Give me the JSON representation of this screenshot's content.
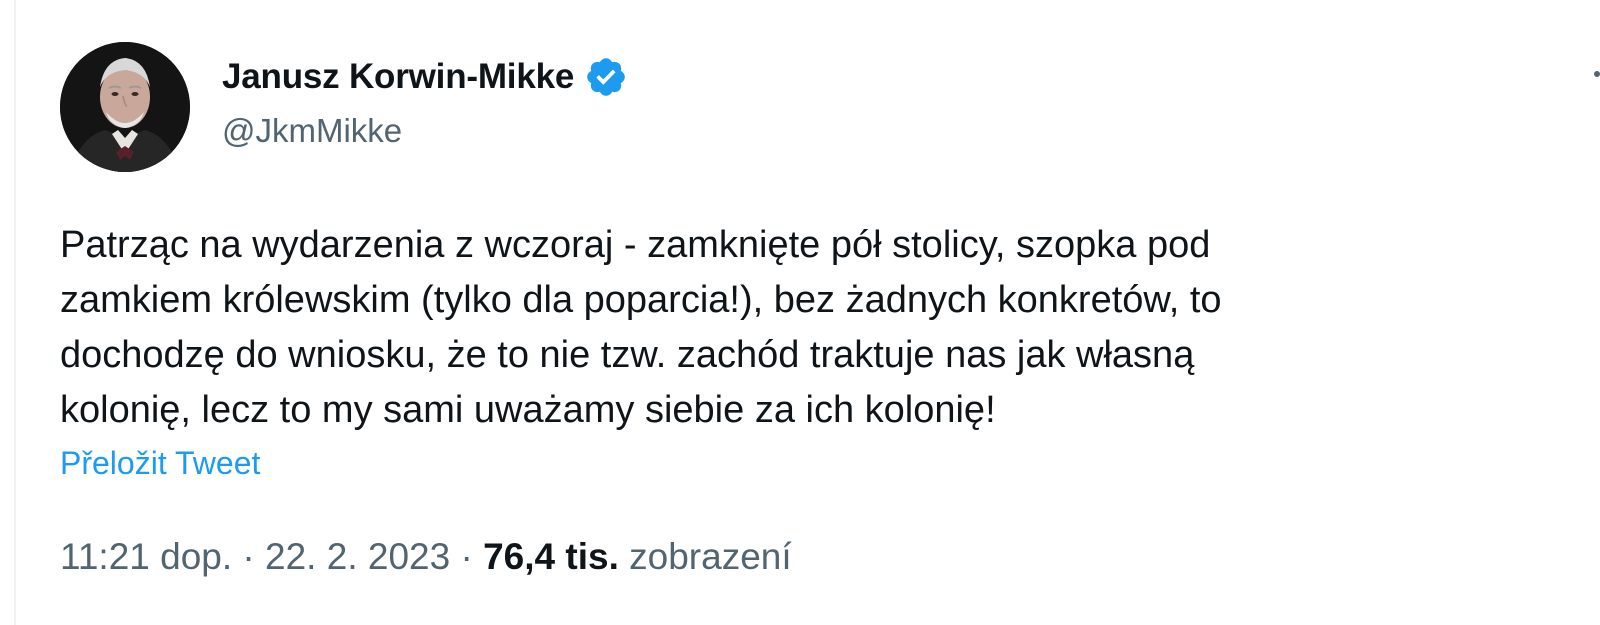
{
  "author": {
    "display_name": "Janusz Korwin-Mikke",
    "handle": "@JkmMikke",
    "verified": true,
    "verified_color": "#1d9bf0"
  },
  "icons": {
    "verified": "verified-badge-icon",
    "more": "more-options-icon",
    "avatar": "profile-avatar"
  },
  "tweet": {
    "text": "Patrząc na wydarzenia z wczoraj - zamknięte pół stolicy, szopka pod\nzamkiem królewskim (tylko dla poparcia!), bez żadnych konkretów, to\ndochodzę do wniosku, że to nie tzw. zachód traktuje nas jak własną\nkolonię, lecz to my sami uważamy siebie za ich kolonię!",
    "translate_label": "Přeložit Tweet"
  },
  "meta": {
    "time": "11:21 dop.",
    "separator": "·",
    "date": "22. 2. 2023",
    "views_count": "76,4 tis.",
    "views_label": "zobrazení"
  },
  "colors": {
    "link": "#1d9bf0",
    "secondary_text": "#536471",
    "primary_text": "#0f1419"
  }
}
